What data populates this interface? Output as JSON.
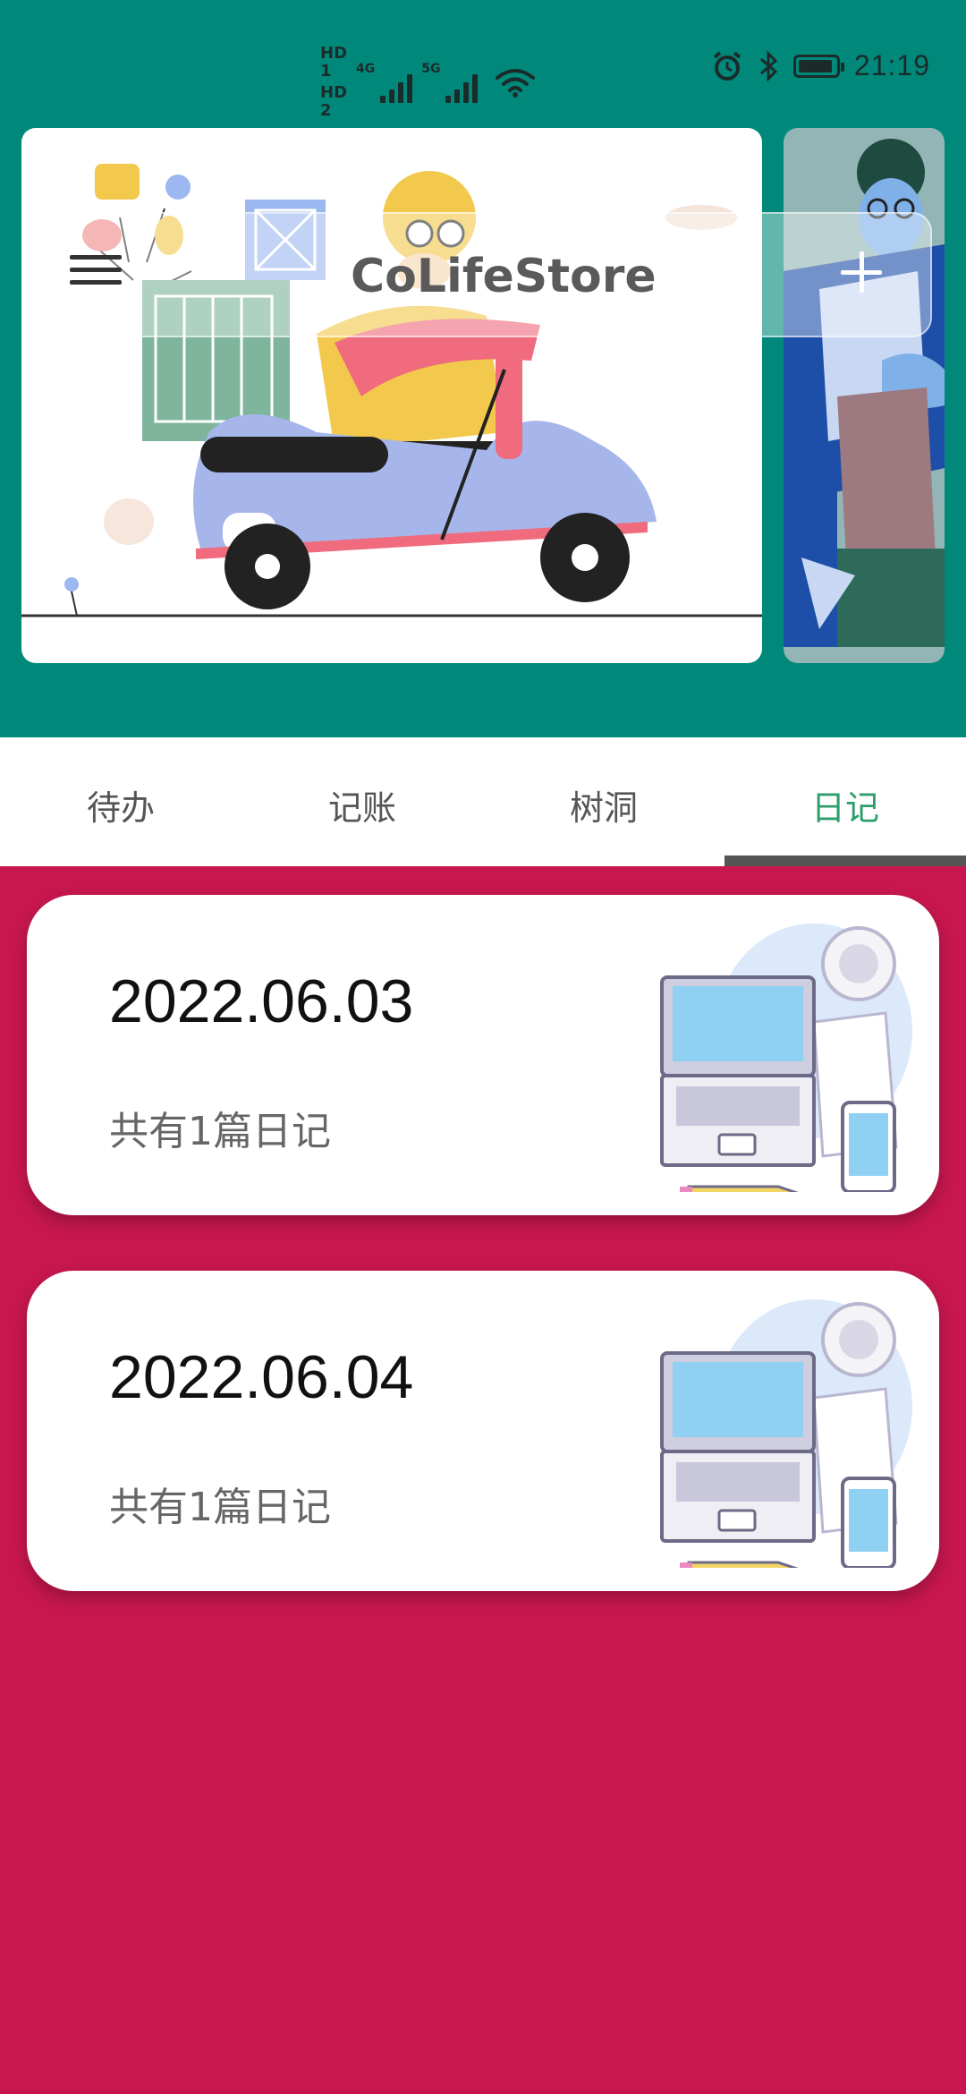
{
  "status_bar": {
    "hd1": "HD",
    "hd2": "HD",
    "sim1": "1",
    "sim2": "2",
    "net1": "4G",
    "net2": "5G",
    "time": "21:19"
  },
  "app_bar": {
    "title": "CoLifeStore"
  },
  "tabs": [
    {
      "label": "待办",
      "active": false
    },
    {
      "label": "记账",
      "active": false
    },
    {
      "label": "树洞",
      "active": false
    },
    {
      "label": "日记",
      "active": true
    }
  ],
  "diary": [
    {
      "date": "2022.06.03",
      "count_label": "共有1篇日记"
    },
    {
      "date": "2022.06.04",
      "count_label": "共有1篇日记"
    }
  ],
  "colors": {
    "header_bg": "#00897b",
    "content_bg": "#c8174f",
    "active_tab": "#2e9e6a"
  }
}
